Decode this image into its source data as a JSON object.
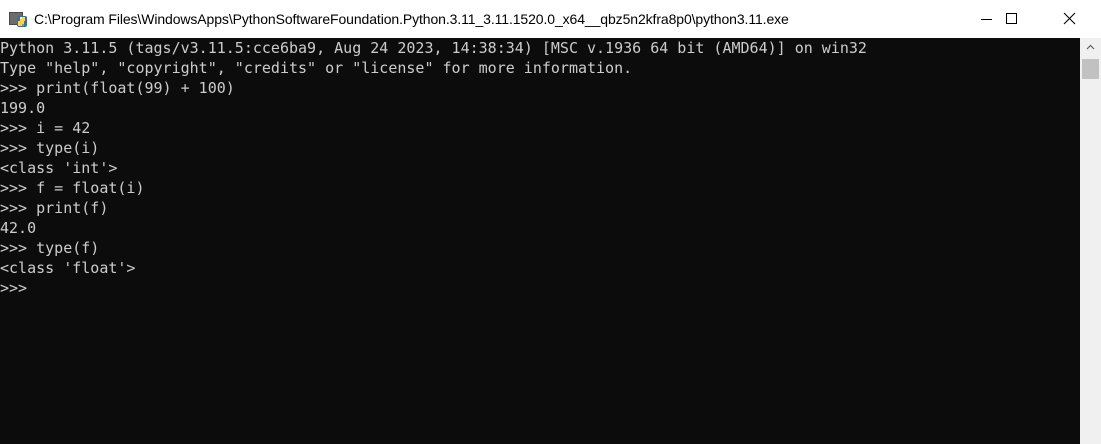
{
  "window": {
    "title": "C:\\Program Files\\WindowsApps\\PythonSoftwareFoundation.Python.3.11_3.11.1520.0_x64__qbz5n2kfra8p0\\python3.11.exe",
    "icon": "python-icon"
  },
  "controls": {
    "minimize_icon": "minimize-icon",
    "maximize_icon": "maximize-icon",
    "close_icon": "close-icon"
  },
  "console": {
    "lines": [
      "Python 3.11.5 (tags/v3.11.5:cce6ba9, Aug 24 2023, 14:38:34) [MSC v.1936 64 bit (AMD64)] on win32",
      "Type \"help\", \"copyright\", \"credits\" or \"license\" for more information.",
      ">>> print(float(99) + 100)",
      "199.0",
      ">>> i = 42",
      ">>> type(i)",
      "<class 'int'>",
      ">>> f = float(i)",
      ">>> print(f)",
      "42.0",
      ">>> type(f)",
      "<class 'float'>",
      ">>>"
    ]
  },
  "colors": {
    "console_background": "#0c0c0c",
    "console_text": "#cccccc",
    "titlebar_background": "#ffffff"
  }
}
